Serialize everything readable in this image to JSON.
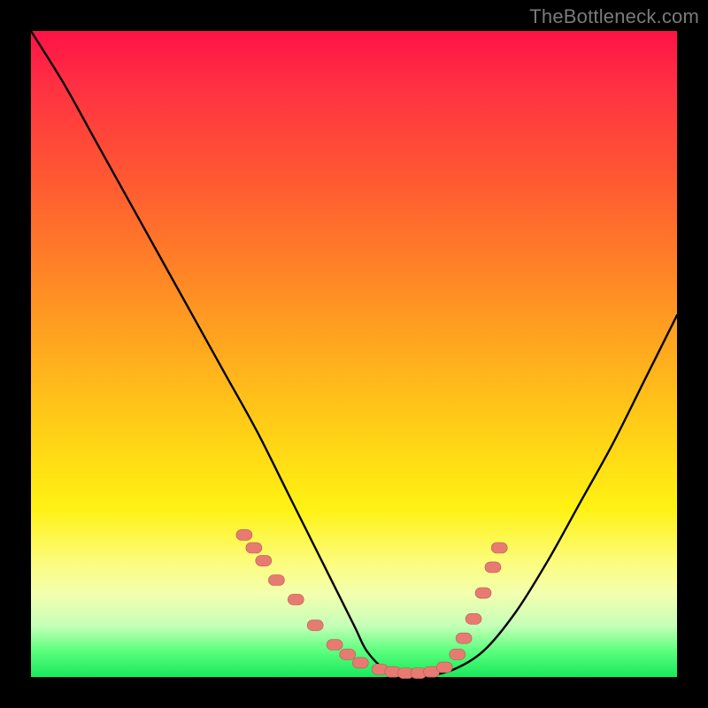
{
  "watermark": "TheBottleneck.com",
  "colors": {
    "background": "#000000",
    "curve": "#000000",
    "point_fill": "#e77b72",
    "point_stroke": "#b85a52",
    "gradient_stops": [
      "#ff1246",
      "#ff2f43",
      "#ff5633",
      "#ff7d28",
      "#ffa51f",
      "#ffd016",
      "#fff213",
      "#fcfc7a",
      "#f4ffae",
      "#c6ffb8",
      "#5bff7e",
      "#18e85a"
    ]
  },
  "chart_data": {
    "type": "line",
    "title": "",
    "xlabel": "",
    "ylabel": "",
    "xlim": [
      0,
      100
    ],
    "ylim": [
      0,
      100
    ],
    "grid": false,
    "series": [
      {
        "name": "bottleneck-curve",
        "x": [
          0,
          5,
          10,
          15,
          20,
          25,
          30,
          35,
          40,
          45,
          50,
          52,
          55,
          58,
          60,
          65,
          70,
          75,
          80,
          85,
          90,
          95,
          100
        ],
        "y": [
          100,
          92,
          83,
          74,
          65,
          56,
          47,
          38,
          28,
          18,
          8,
          4,
          1,
          0,
          0,
          1,
          4,
          10,
          18,
          27,
          36,
          46,
          56
        ]
      }
    ],
    "points_series": [
      {
        "name": "highlight-points",
        "x": [
          33,
          34.5,
          36,
          38,
          41,
          44,
          47,
          49,
          51,
          54,
          56,
          58,
          60,
          62,
          64,
          66,
          67,
          68.5,
          70,
          71.5,
          72.5
        ],
        "y": [
          22,
          20,
          18,
          15,
          12,
          8,
          5,
          3.5,
          2.2,
          1.2,
          0.8,
          0.6,
          0.6,
          0.8,
          1.5,
          3.5,
          6,
          9,
          13,
          17,
          20
        ]
      }
    ]
  }
}
